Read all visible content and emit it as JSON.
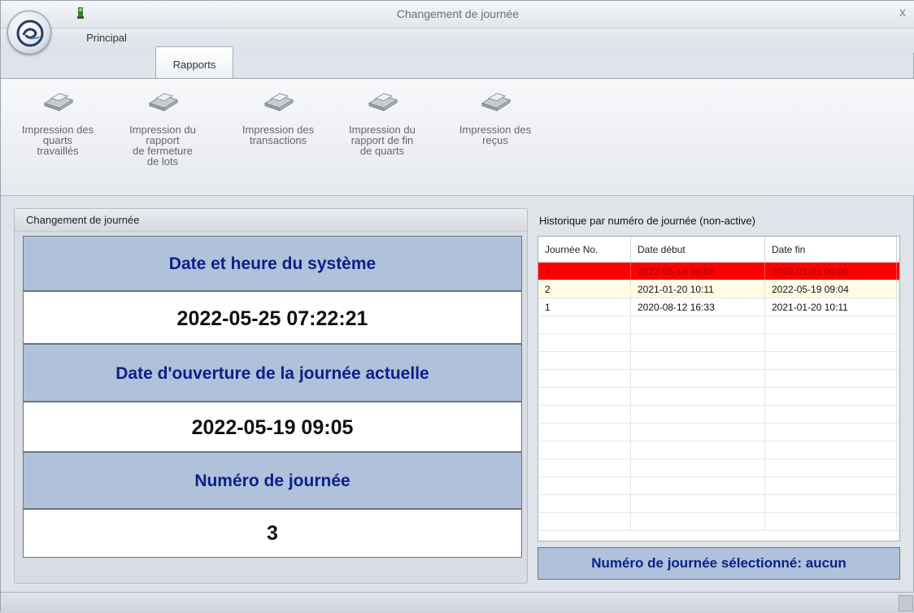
{
  "window": {
    "title": "Changement de journée",
    "close_glyph": "x"
  },
  "tabs": [
    {
      "label": "Principal",
      "active": false
    },
    {
      "label": "Rapports",
      "active": true
    }
  ],
  "ribbon": {
    "buttons": [
      {
        "icon": "printer-icon",
        "lines": [
          "Impression des",
          "quarts",
          "travaillés"
        ]
      },
      {
        "icon": "printer-icon",
        "lines": [
          "Impression du",
          "rapport",
          "de fermeture",
          "de lots"
        ]
      },
      {
        "icon": "printer-icon",
        "lines": [
          "Impression des",
          "transactions"
        ]
      },
      {
        "icon": "printer-icon",
        "lines": [
          "Impression du",
          "rapport de fin",
          "de quarts"
        ]
      },
      {
        "icon": "printer-icon",
        "lines": [
          "Impression des",
          "reçus"
        ]
      }
    ]
  },
  "left_panel": {
    "header": "Changement de journée",
    "system_date_label": "Date et heure du système",
    "system_date_value": "2022-05-25 07:22:21",
    "opening_date_label": "Date d'ouverture de la journée actuelle",
    "opening_date_value": "2022-05-19 09:05",
    "day_number_label": "Numéro de journée",
    "day_number_value": "3"
  },
  "history": {
    "title": "Historique par numéro de journée (non-active)",
    "columns": [
      "Journée No.",
      "Date début",
      "Date fin"
    ],
    "rows": [
      {
        "no": "3",
        "start": "2022-05-19 09:05",
        "end": "2099-01-01 00:00",
        "style": "red"
      },
      {
        "no": "2",
        "start": "2021-01-20 10:11",
        "end": "2022-05-19 09:04",
        "style": "yellow"
      },
      {
        "no": "1",
        "start": "2020-08-12 16:33",
        "end": "2021-01-20 10:11",
        "style": "white"
      }
    ],
    "selected_text": "Numéro de journée sélectionné: aucun"
  },
  "colors": {
    "label_bg": "#b0c2db",
    "label_text": "#0c1f8a",
    "active_row": "#fe0000"
  }
}
